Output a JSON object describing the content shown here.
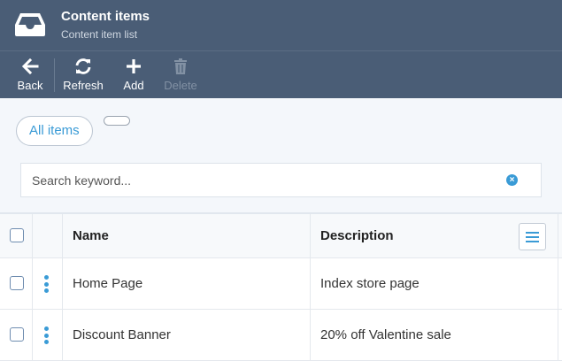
{
  "header": {
    "title": "Content items",
    "subtitle": "Content item list",
    "logo_icon": "inbox-tray-icon"
  },
  "toolbar": {
    "back_label": "Back",
    "refresh_label": "Refresh",
    "add_label": "Add",
    "delete_label": "Delete"
  },
  "filters": {
    "active_label": "All items"
  },
  "search": {
    "placeholder": "Search keyword...",
    "value": ""
  },
  "table": {
    "headers": {
      "name": "Name",
      "description": "Description"
    },
    "rows": [
      {
        "name": "Home Page",
        "description": "Index store page"
      },
      {
        "name": "Discount Banner",
        "description": "20% off Valentine sale"
      }
    ]
  },
  "colors": {
    "header_bg": "#4a5d76",
    "accent": "#3a9bd6",
    "content_bg": "#f4f7fb"
  }
}
